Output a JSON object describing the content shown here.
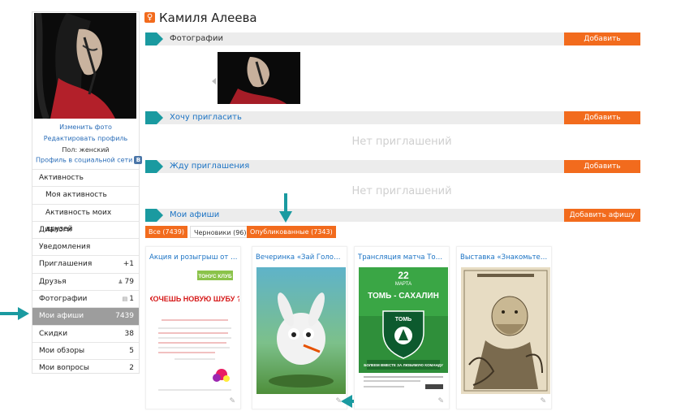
{
  "profile": {
    "name": "Камиля Алеева",
    "change_photo": "Изменить фото",
    "edit_profile": "Редактировать профиль",
    "gender": "Пол: женский",
    "social_profile": "Профиль в социальной сети",
    "social_badge": "B"
  },
  "menu": [
    {
      "label": "Активность",
      "count": ""
    },
    {
      "label": "Моя активность",
      "count": ""
    },
    {
      "label": "Активность моих друзей",
      "count": ""
    },
    {
      "label": "Диалоги",
      "count": ""
    },
    {
      "label": "Уведомления",
      "count": ""
    },
    {
      "label": "Приглашения",
      "count": "+1"
    },
    {
      "label": "Друзья",
      "count": "79"
    },
    {
      "label": "Фотографии",
      "count": "1"
    },
    {
      "label": "Мои афиши",
      "count": "7439"
    },
    {
      "label": "Скидки",
      "count": "38"
    },
    {
      "label": "Мои обзоры",
      "count": "5"
    },
    {
      "label": "Мои вопросы",
      "count": "2"
    }
  ],
  "sections": {
    "photos": {
      "label": "Фотографии",
      "button": "Добавить"
    },
    "want_invite": {
      "label": "Хочу пригласить",
      "button": "Добавить",
      "empty": "Нет приглашений"
    },
    "waiting": {
      "label": "Жду приглашения",
      "button": "Добавить",
      "empty": "Нет приглашений"
    },
    "my_posters": {
      "label": "Мои афиши",
      "button": "Добавить афишу"
    }
  },
  "filters": {
    "all": "Все (7439)",
    "drafts": "Черновики (96)",
    "published": "Опубликованные (7343)"
  },
  "cards": [
    {
      "title": "Акция и розыгрыш от Т...",
      "poster": {
        "brand": "ТОНУС КЛУБ",
        "headline": "ХОЧЕШЬ НОВУЮ ШУБУ ?"
      }
    },
    {
      "title": "Вечеринка «Зай Голод!»"
    },
    {
      "title": "Трансляция матча Томь...",
      "poster": {
        "day": "22",
        "month": "МАРТА",
        "match": "ТОМЬ - САХАЛИН",
        "club": "ТОМЬ",
        "slogan": "БОЛЕЕМ ВМЕСТЕ ЗА ЛЮБИМУЮ КОМАНДУ"
      }
    },
    {
      "title": "Выставка «Знакомьтесь..."
    }
  ],
  "colors": {
    "accent": "#f26b1d",
    "teal": "#1a9aa0",
    "link": "#1b73c4",
    "active_menu": "#9d9d9d"
  }
}
